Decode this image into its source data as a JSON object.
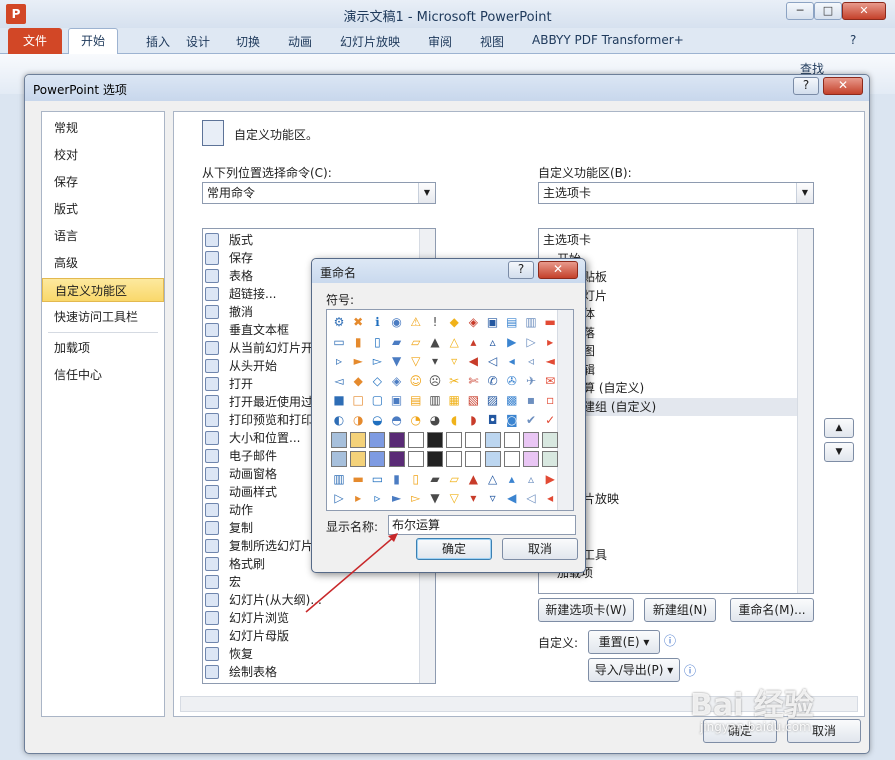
{
  "app": {
    "title": "演示文稿1 - Microsoft PowerPoint",
    "logo_letter": "P",
    "tabs": [
      "文件",
      "开始",
      "插入",
      "设计",
      "切换",
      "动画",
      "幻灯片放映",
      "审阅",
      "视图",
      "ABBYY PDF Transformer+"
    ],
    "ribbon_find": "查找"
  },
  "dialog": {
    "title": "PowerPoint 选项",
    "nav": [
      "常规",
      "校对",
      "保存",
      "版式",
      "语言",
      "高级",
      "自定义功能区",
      "快速访问工具栏",
      "加载项",
      "信任中心"
    ],
    "header": "自定义功能区。",
    "left_label": "从下列位置选择命令(C):",
    "left_combo": "常用命令",
    "right_label": "自定义功能区(B):",
    "right_combo": "主选项卡",
    "commands": [
      "版式",
      "保存",
      "表格",
      "超链接...",
      "撤消",
      "垂直文本框",
      "从当前幻灯片开",
      "从头开始",
      "打开",
      "打开最近使用过",
      "打印预览和打印",
      "大小和位置...",
      "电子邮件",
      "动画窗格",
      "动画样式",
      "动作",
      "复制",
      "复制所选幻灯片",
      "格式刷",
      "宏",
      "幻灯片(从大纲)...",
      "幻灯片浏览",
      "幻灯片母版",
      "恢复",
      "绘制表格"
    ],
    "tree": [
      {
        "text": "主选项卡",
        "indent": 0
      },
      {
        "text": "开始",
        "indent": 1
      },
      {
        "text": "剪贴板",
        "indent": 2
      },
      {
        "text": "幻灯片",
        "indent": 2
      },
      {
        "text": "字体",
        "indent": 2
      },
      {
        "text": "段落",
        "indent": 2
      },
      {
        "text": "绘图",
        "indent": 2
      },
      {
        "text": "编辑",
        "indent": 2
      },
      {
        "text": "运算 (自定义)",
        "indent": 2
      },
      {
        "text": "新建组 (自定义)",
        "indent": 2
      },
      {
        "text": "",
        "indent": 2
      },
      {
        "text": "",
        "indent": 2
      },
      {
        "text": "",
        "indent": 2
      },
      {
        "text": "",
        "indent": 2
      },
      {
        "text": "灯片放映",
        "indent": 2
      },
      {
        "text": "",
        "indent": 2
      },
      {
        "text": "",
        "indent": 2
      },
      {
        "text": "发工具",
        "indent": 2
      },
      {
        "text": "加载项",
        "indent": 1
      }
    ],
    "new_tab_button": "新建选项卡(W)",
    "new_group_button": "新建组(N)",
    "rename_button": "重命名(M)...",
    "customize_label": "自定义:",
    "reset_button": "重置(E) ▾",
    "import_export_button": "导入/导出(P) ▾",
    "ok_button": "确定",
    "cancel_button": "取消"
  },
  "rename": {
    "title": "重命名",
    "help": "?",
    "symbol_label": "符号:",
    "name_label": "显示名称:",
    "name_value": "布尔运算",
    "ok": "确定",
    "cancel": "取消"
  },
  "watermark": {
    "main": "Bai 经验",
    "sub": "jingyan.baidu.com"
  }
}
